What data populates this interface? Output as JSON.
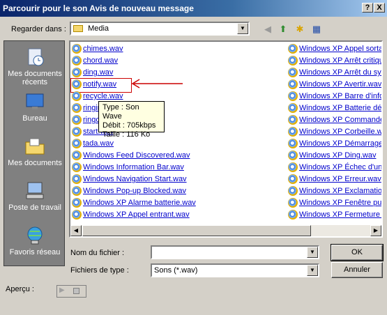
{
  "window": {
    "title": "Parcourir pour le son Avis de nouveau message",
    "help_label": "?",
    "close_label": "X"
  },
  "lookin": {
    "label": "Regarder dans :",
    "value": "Media"
  },
  "places": [
    {
      "label": "Mes documents récents"
    },
    {
      "label": "Bureau"
    },
    {
      "label": "Mes documents"
    },
    {
      "label": "Poste de travail"
    },
    {
      "label": "Favoris réseau"
    }
  ],
  "files_col1": [
    "chimes.wav",
    "chord.wav",
    "ding.wav",
    "notify.wav",
    "recycle.wav",
    "ringin.wav",
    "ringout.wav",
    "start.wav",
    "tada.wav",
    "Windows Feed Discovered.wav",
    "Windows Information Bar.wav",
    "Windows Navigation Start.wav",
    "Windows Pop-up Blocked.wav",
    "Windows XP Alarme batterie.wav",
    "Windows XP Appel entrant.wav"
  ],
  "files_col2": [
    "Windows XP Appel sortant.wav",
    "Windows XP Arrêt critique.wav",
    "Windows XP Arrêt du système.wav",
    "Windows XP Avertir.wav",
    "Windows XP Barre d'informations.wav",
    "Windows XP Batterie déchargée.wav",
    "Windows XP Commande de menu.wav",
    "Windows XP Corbeille.wav",
    "Windows XP Démarrage.wav",
    "Windows XP Ding.wav",
    "Windows XP Échec d'un rapport.wav",
    "Windows XP Erreur.wav",
    "Windows XP Exclamation.wav",
    "Windows XP Fenêtre publicitaire.wav",
    "Windows XP Fermeture de session.wav"
  ],
  "tooltip": {
    "type": "Type : Son Wave",
    "rate": "Débit : 705kbps",
    "size": "Taille : 116 Ko"
  },
  "filename": {
    "label": "Nom du fichier :",
    "value": ""
  },
  "filetype": {
    "label": "Fichiers de type :",
    "value": "Sons (*.wav)"
  },
  "buttons": {
    "ok": "OK",
    "cancel": "Annuler"
  },
  "preview": {
    "label": "Aperçu :"
  },
  "colors": {
    "link": "#0000cc",
    "title_start": "#0a246a",
    "highlight": "#cc0000"
  }
}
